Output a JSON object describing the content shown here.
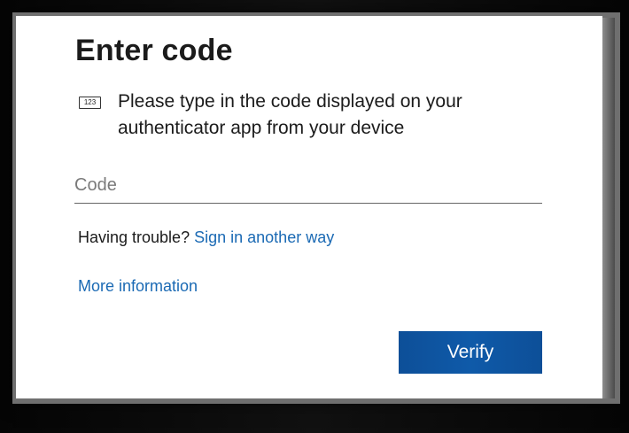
{
  "dialog": {
    "title": "Enter code",
    "instruction_icon": "numeric-code-icon",
    "instruction_icon_text": "123",
    "instruction_text": "Please type in the code displayed on your authenticator app from your device",
    "code_input": {
      "placeholder": "Code",
      "value": ""
    },
    "trouble_text": "Having trouble?",
    "trouble_link": "Sign in another way",
    "more_info_link": "More information",
    "verify_label": "Verify"
  },
  "colors": {
    "link": "#1b6ab4",
    "button_bg": "#0f5aa9",
    "button_text": "#ffffff",
    "text": "#1b1b1b",
    "background": "#ffffff"
  }
}
